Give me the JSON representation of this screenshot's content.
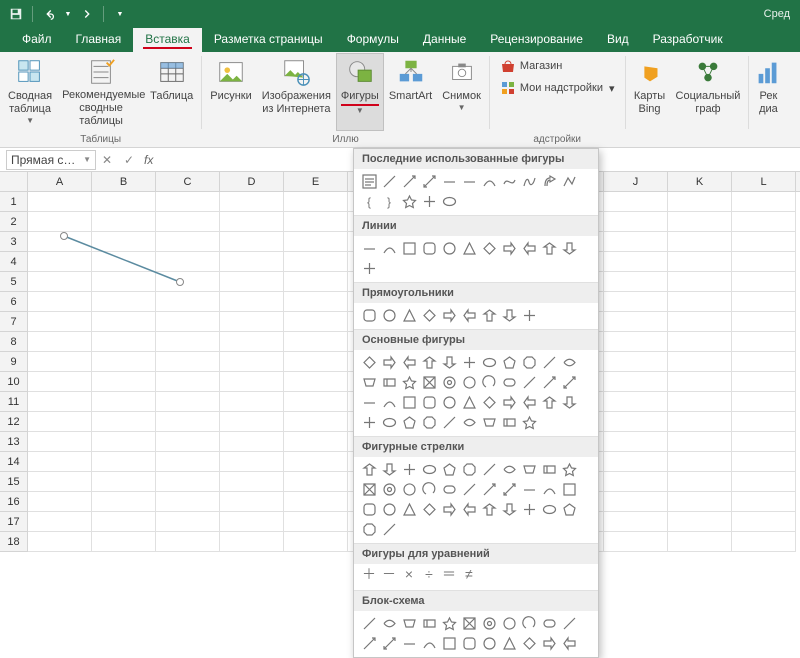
{
  "titlebar": {
    "right_text": "Сред"
  },
  "tabs": [
    "Файл",
    "Главная",
    "Вставка",
    "Разметка страницы",
    "Формулы",
    "Данные",
    "Рецензирование",
    "Вид",
    "Разработчик"
  ],
  "active_tab_index": 2,
  "ribbon": {
    "groups": {
      "tables": {
        "label": "Таблицы",
        "pivot": "Сводная\nтаблица",
        "recpivot": "Рекомендуемые\nсводные таблицы",
        "table": "Таблица"
      },
      "illus": {
        "label": "Иллю",
        "pictures": "Рисунки",
        "online": "Изображения\nиз Интернета",
        "shapes": "Фигуры",
        "smartart": "SmartArt",
        "screenshot": "Снимок"
      },
      "addins": {
        "label": "адстройки",
        "store": "Магазин",
        "myaddins": "Мои надстройки"
      },
      "maps": {
        "bing": "Карты\nBing",
        "social": "Социальный\nграф"
      },
      "rec": {
        "label": "Рек\nдиа"
      }
    }
  },
  "formula_bar": {
    "name_box": "Прямая с…",
    "cancel": "✕",
    "confirm": "✓",
    "fx": "fx"
  },
  "grid": {
    "cols": [
      "A",
      "B",
      "C",
      "D",
      "E",
      "",
      "",
      "",
      "",
      "J",
      "K",
      "L"
    ],
    "row_count": 18
  },
  "shapes_menu": {
    "sections": [
      {
        "title": "Последние использованные фигуры",
        "count": 16
      },
      {
        "title": "Линии",
        "count": 12
      },
      {
        "title": "Прямоугольники",
        "count": 9
      },
      {
        "title": "Основные фигуры",
        "count": 42
      },
      {
        "title": "Фигурные стрелки",
        "count": 35
      },
      {
        "title": "Фигуры для уравнений",
        "count": 6
      },
      {
        "title": "Блок-схема",
        "count": 22
      }
    ]
  }
}
